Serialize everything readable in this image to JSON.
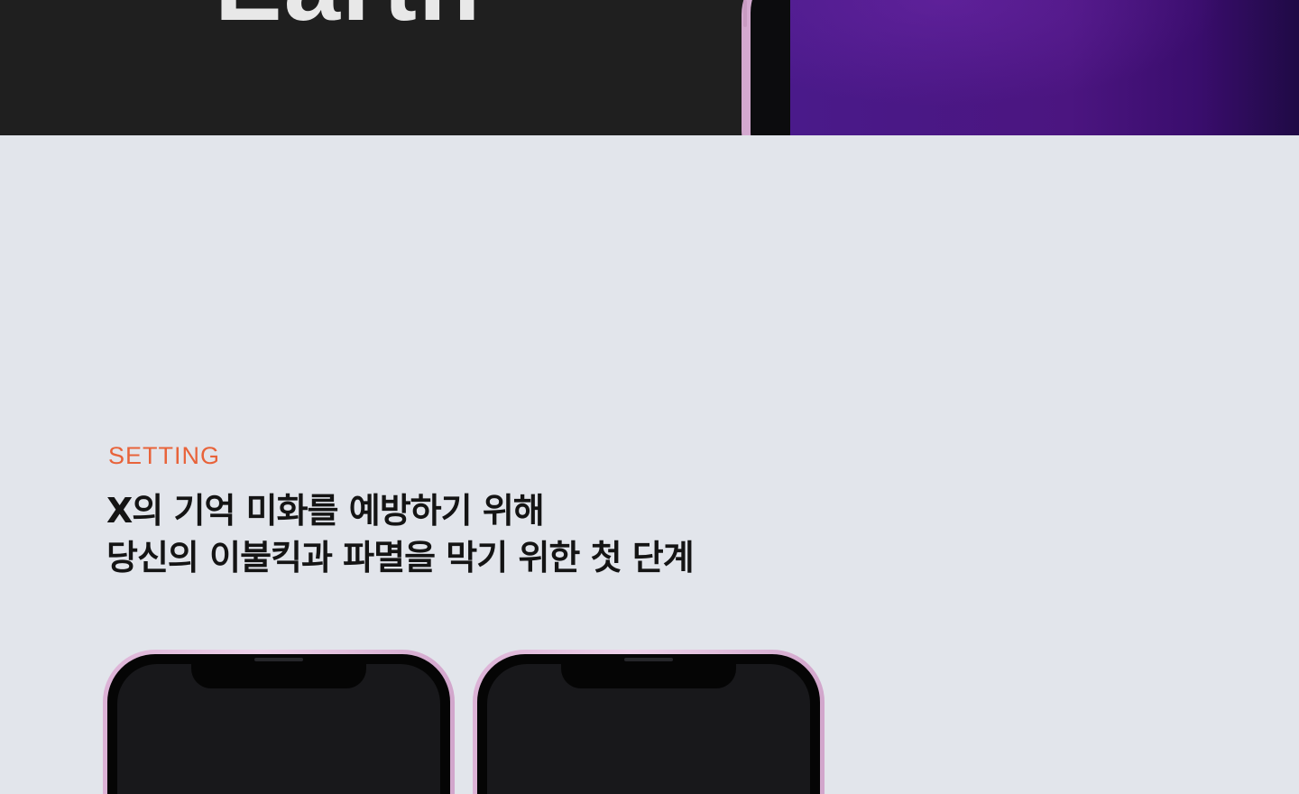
{
  "hero": {
    "word": "Earth",
    "background": "#1f1f1f",
    "screen_color": "#4a1a8a"
  },
  "section": {
    "label": "SETTING",
    "label_color": "#e8633a",
    "headline_line1": "X의 기억 미화를 예방하기 위해",
    "headline_line2": "당신의 이불킥과 파멸을 막기 위한 첫 단계",
    "background": "#e2e5eb"
  },
  "phones": {
    "frame_color": "#dcb2d6",
    "screen_color": "#18181b"
  }
}
